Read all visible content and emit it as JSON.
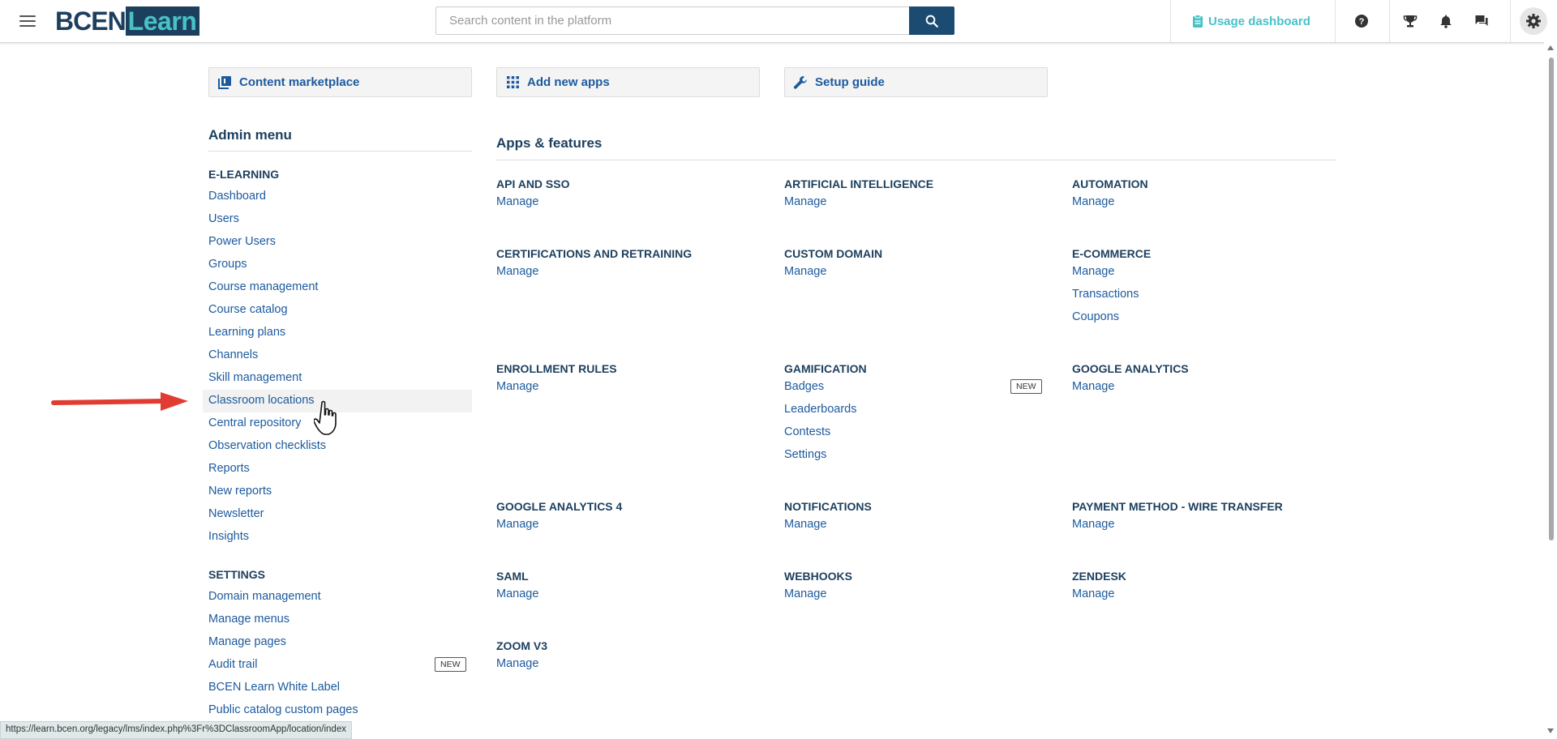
{
  "header": {
    "menu_icon": "hamburger-icon",
    "logo_part1": "BCEN",
    "logo_part2": "Learn",
    "search_placeholder": "Search content in the platform",
    "search_icon": "magnifier-icon",
    "usage_dashboard_label": "Usage dashboard",
    "icons": [
      "help-icon",
      "trophy-icon",
      "bell-icon",
      "chat-icon",
      "gear-icon"
    ]
  },
  "quick_actions": [
    {
      "label": "Content marketplace",
      "icon": "library-icon"
    },
    {
      "label": "Add new apps",
      "icon": "grid-icon"
    },
    {
      "label": "Setup guide",
      "icon": "wrench-icon"
    }
  ],
  "admin_menu": {
    "title": "Admin menu",
    "elearning_label": "E-LEARNING",
    "elearning_items": [
      "Dashboard",
      "Users",
      "Power Users",
      "Groups",
      "Course management",
      "Course catalog",
      "Learning plans",
      "Channels",
      "Skill management",
      "Classroom locations",
      "Central repository",
      "Observation checklists",
      "Reports",
      "New reports",
      "Newsletter",
      "Insights"
    ],
    "settings_label": "SETTINGS",
    "settings_items": [
      "Domain management",
      "Manage menus",
      "Manage pages",
      "Audit trail",
      "BCEN Learn White Label",
      "Public catalog custom pages"
    ],
    "audit_trail_badge": "NEW",
    "highlighted_item": "Classroom locations"
  },
  "apps": {
    "title": "Apps & features",
    "items": [
      {
        "title": "API AND SSO",
        "links": [
          "Manage"
        ]
      },
      {
        "title": "ARTIFICIAL INTELLIGENCE",
        "links": [
          "Manage"
        ]
      },
      {
        "title": "AUTOMATION",
        "links": [
          "Manage"
        ]
      },
      {
        "title": "CERTIFICATIONS AND RETRAINING",
        "links": [
          "Manage"
        ]
      },
      {
        "title": "CUSTOM DOMAIN",
        "links": [
          "Manage"
        ]
      },
      {
        "title": "E-COMMERCE",
        "links": [
          "Manage",
          "Transactions",
          "Coupons"
        ]
      },
      {
        "title": "ENROLLMENT RULES",
        "links": [
          "Manage"
        ]
      },
      {
        "title": "GAMIFICATION",
        "links": [
          "Badges",
          "Leaderboards",
          "Contests",
          "Settings"
        ],
        "badge": "NEW"
      },
      {
        "title": "GOOGLE ANALYTICS",
        "links": [
          "Manage"
        ]
      },
      {
        "title": "GOOGLE ANALYTICS 4",
        "links": [
          "Manage"
        ]
      },
      {
        "title": "NOTIFICATIONS",
        "links": [
          "Manage"
        ]
      },
      {
        "title": "PAYMENT METHOD - WIRE TRANSFER",
        "links": [
          "Manage"
        ]
      },
      {
        "title": "SAML",
        "links": [
          "Manage"
        ]
      },
      {
        "title": "WEBHOOKS",
        "links": [
          "Manage"
        ]
      },
      {
        "title": "ZENDESK",
        "links": [
          "Manage"
        ]
      },
      {
        "title": "ZOOM V3",
        "links": [
          "Manage"
        ]
      }
    ]
  },
  "status_url": "https://learn.bcen.org/legacy/lms/index.php%3Fr%3DClassroomApp/location/index",
  "colors": {
    "navy": "#1c3f5e",
    "link": "#1c5a9e",
    "accent_teal": "#48c2c5",
    "search_button": "#1c4b72",
    "arrow_red": "#e03c31"
  }
}
